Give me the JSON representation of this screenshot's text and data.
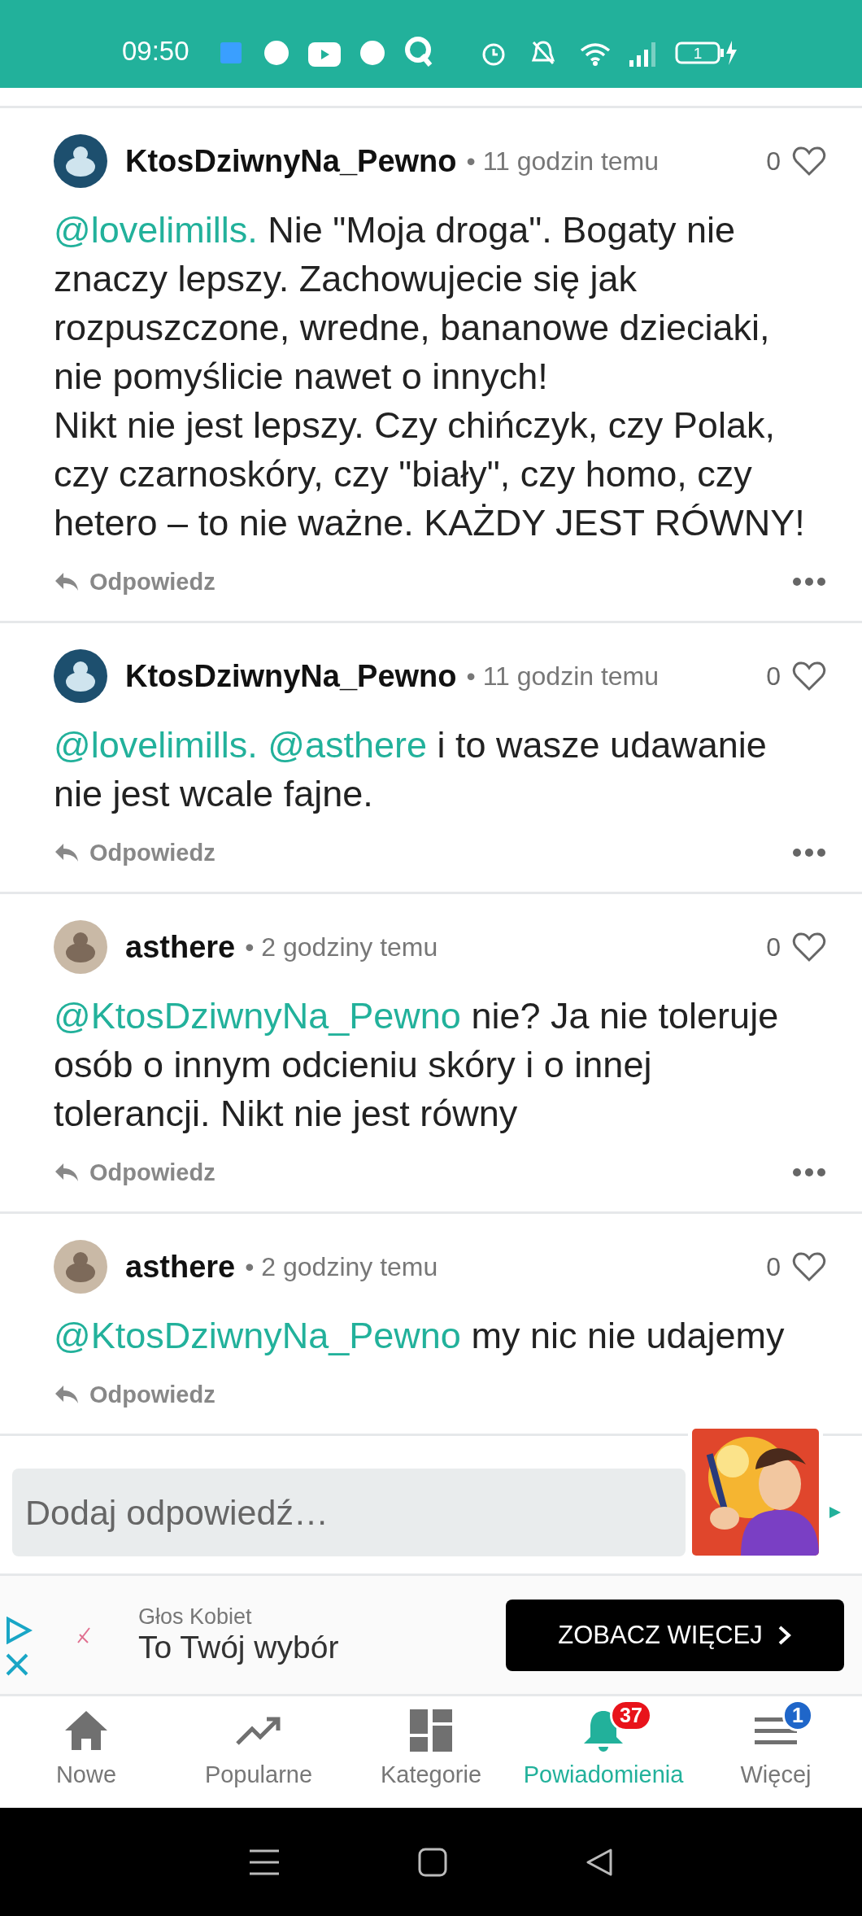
{
  "status_bar": {
    "time": "09:50",
    "battery": "1"
  },
  "comments": [
    {
      "user": "KtosDziwnyNa_Pewno",
      "time": "• 11 godzin temu",
      "likes": "0",
      "mentions": [
        "@lovelimills."
      ],
      "text": "Nie \"Moja droga\". Bogaty nie znaczy lepszy. Zachowujecie się jak rozpuszczone, wredne, bananowe dzieciaki, nie pomyślicie nawet o innych!\nNikt nie jest lepszy. Czy chińczyk, czy Polak, czy czarnoskóry, czy \"biały\", czy homo, czy hetero – to nie ważne. KAŻDY JEST RÓWNY!",
      "reply": "Odpowiedz",
      "more": true
    },
    {
      "user": "KtosDziwnyNa_Pewno",
      "time": "• 11 godzin temu",
      "likes": "0",
      "mentions": [
        "@lovelimills.",
        "@asthere"
      ],
      "text": "i to wasze udawanie nie jest wcale fajne.",
      "reply": "Odpowiedz",
      "more": true
    },
    {
      "user": "asthere",
      "time": "• 2 godziny temu",
      "likes": "0",
      "mentions": [
        "@KtosDziwnyNa_Pewno"
      ],
      "text": "nie? Ja nie toleruje osób o innym odcieniu skóry i o innej tolerancji. Nikt nie jest równy",
      "reply": "Odpowiedz",
      "more": true
    },
    {
      "user": "asthere",
      "time": "• 2 godziny temu",
      "likes": "0",
      "mentions": [
        "@KtosDziwnyNa_Pewno"
      ],
      "text": "my nic nie udajemy",
      "reply": "Odpowiedz",
      "more": false
    }
  ],
  "reply_box": {
    "placeholder": "Dodaj odpowiedź…"
  },
  "ad": {
    "brand": "Głos Kobiet",
    "headline": "To Twój wybór",
    "cta": "ZOBACZ WIĘCEJ"
  },
  "nav": [
    {
      "kind": "home",
      "label": "Nowe",
      "selected": false
    },
    {
      "kind": "trending",
      "label": "Popularne",
      "selected": false
    },
    {
      "kind": "categories",
      "label": "Kategorie",
      "selected": false
    },
    {
      "kind": "bell",
      "label": "Powiadomienia",
      "selected": true,
      "badge": {
        "text": "37",
        "color": "#e8131b"
      }
    },
    {
      "kind": "menu",
      "label": "Więcej",
      "selected": false,
      "badge": {
        "text": "1",
        "color": "#1f66c9"
      }
    }
  ]
}
